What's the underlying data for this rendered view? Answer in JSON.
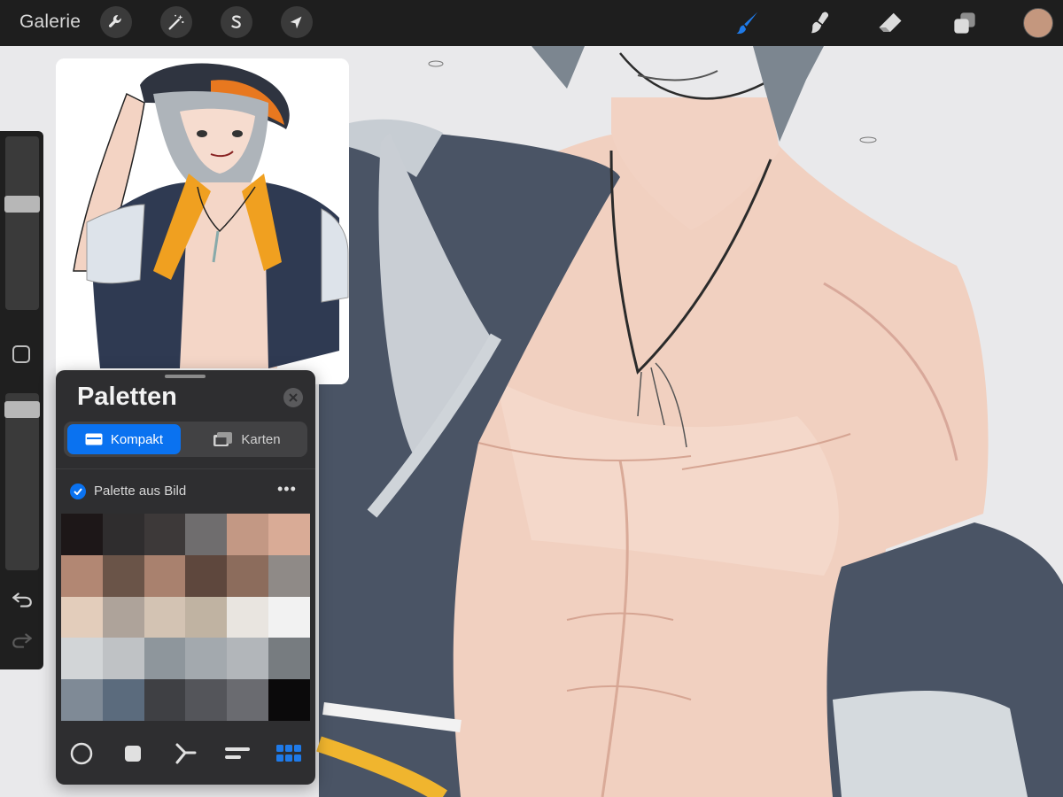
{
  "app": {
    "gallery_label": "Galerie"
  },
  "toolbar": {
    "left_tools": [
      {
        "name": "adjustments",
        "icon": "wrench-icon"
      },
      {
        "name": "selection-magic",
        "icon": "magic-wand-icon"
      },
      {
        "name": "selection",
        "icon": "selection-s-icon"
      },
      {
        "name": "transform",
        "icon": "arrow-cursor-icon"
      }
    ],
    "right_tools": [
      {
        "name": "brush",
        "icon": "brush-icon",
        "active": true
      },
      {
        "name": "smudge",
        "icon": "smudge-icon"
      },
      {
        "name": "eraser",
        "icon": "eraser-icon"
      },
      {
        "name": "layers",
        "icon": "layers-icon"
      }
    ],
    "current_color": "#c4977e",
    "accent": "#1f7ae8"
  },
  "sidebar": {
    "size_slider_level": 0.38,
    "opacity_slider_level": 0.05
  },
  "palettes": {
    "title": "Paletten",
    "view_modes": [
      {
        "label": "Kompakt",
        "icon": "compact-card-icon",
        "active": true
      },
      {
        "label": "Karten",
        "icon": "cards-icon",
        "active": false
      }
    ],
    "palette_name": "Palette aus Bild",
    "more_label": "•••",
    "swatches": [
      "#1d1718",
      "#2f2d2e",
      "#3d3939",
      "#6f6d6e",
      "#c39884",
      "#d9ab96",
      "#b28773",
      "#6a5448",
      "#a9816e",
      "#5e473d",
      "#8c6c5c",
      "#8f8a87",
      "#e3cdbb",
      "#aea39a",
      "#d3c3b3",
      "#c0b3a2",
      "#e9e5e0",
      "#f2f2f2",
      "#d2d5d7",
      "#bfc2c5",
      "#8e969c",
      "#a3a9ae",
      "#b2b6ba",
      "#777c80",
      "#7f8a96",
      "#5b6b7d",
      "#3f4044",
      "#54555a",
      "#6a6b70",
      "#0b0a0b"
    ],
    "bottom_tabs": [
      {
        "name": "disc",
        "icon": "disc-icon"
      },
      {
        "name": "classic",
        "icon": "square-icon"
      },
      {
        "name": "harmony",
        "icon": "harmony-icon"
      },
      {
        "name": "value",
        "icon": "value-sliders-icon"
      },
      {
        "name": "palettes",
        "icon": "grid-palette-icon",
        "active": true
      }
    ]
  }
}
